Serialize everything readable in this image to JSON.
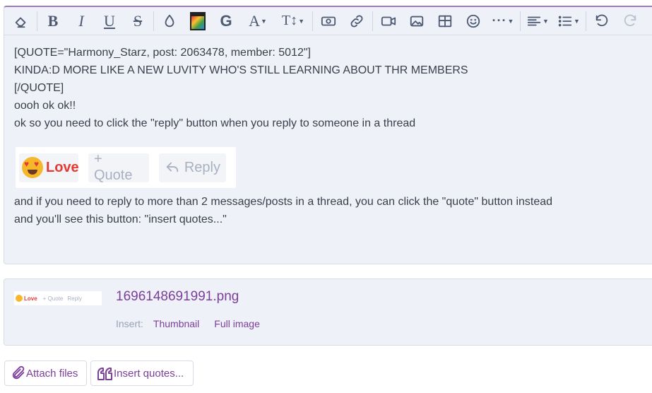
{
  "toolbar": {
    "items": [
      {
        "name": "remove-formatting"
      },
      {
        "name": "bold",
        "glyph": "B"
      },
      {
        "name": "italic",
        "glyph": "I"
      },
      {
        "name": "underline",
        "glyph": "U"
      },
      {
        "name": "strikethrough",
        "glyph": "S"
      },
      {
        "name": "text-color"
      },
      {
        "name": "image-insert"
      },
      {
        "name": "google",
        "glyph": "G"
      },
      {
        "name": "font-family",
        "glyph": "A"
      },
      {
        "name": "font-size",
        "glyph": "T↕"
      },
      {
        "name": "media"
      },
      {
        "name": "link"
      },
      {
        "name": "video"
      },
      {
        "name": "image"
      },
      {
        "name": "table"
      },
      {
        "name": "emoji"
      },
      {
        "name": "more"
      },
      {
        "name": "align"
      },
      {
        "name": "list"
      },
      {
        "name": "undo"
      },
      {
        "name": "redo"
      }
    ]
  },
  "content": {
    "lines": [
      "[QUOTE=\"Harmony_Starz, post: 2063478, member: 5012\"]",
      "KINDA:D MORE LIKE A NEW LUVITY WHO'S STILL LEARNING ABOUT THR MEMBERS",
      "[/QUOTE]",
      "oooh ok ok!!",
      "",
      "ok so you need to click the \"reply\" button when you reply to someone in a thread"
    ],
    "lines_after": [
      "and if you need to reply to more than 2 messages/posts in a thread, you can click the \"quote\" button instead",
      "and you'll see this button: \"insert quotes...\""
    ]
  },
  "embedded_image": {
    "love_label": "Love",
    "quote_label": "+ Quote",
    "reply_label": "Reply"
  },
  "attachment": {
    "thumb_love": "Love",
    "thumb_quote": "+ Quote",
    "thumb_reply": "Reply",
    "filename": "1696148691991.png",
    "insert_label": "Insert:",
    "thumbnail_link": "Thumbnail",
    "full_image_link": "Full image"
  },
  "footer": {
    "attach_label": "Attach files",
    "insert_quotes_label": "Insert quotes..."
  },
  "colors": {
    "accent": "#7b3f9a",
    "toolbar_icon": "#4d5a72",
    "editor_bg": "#eef1f8",
    "love_red": "#e53935"
  }
}
